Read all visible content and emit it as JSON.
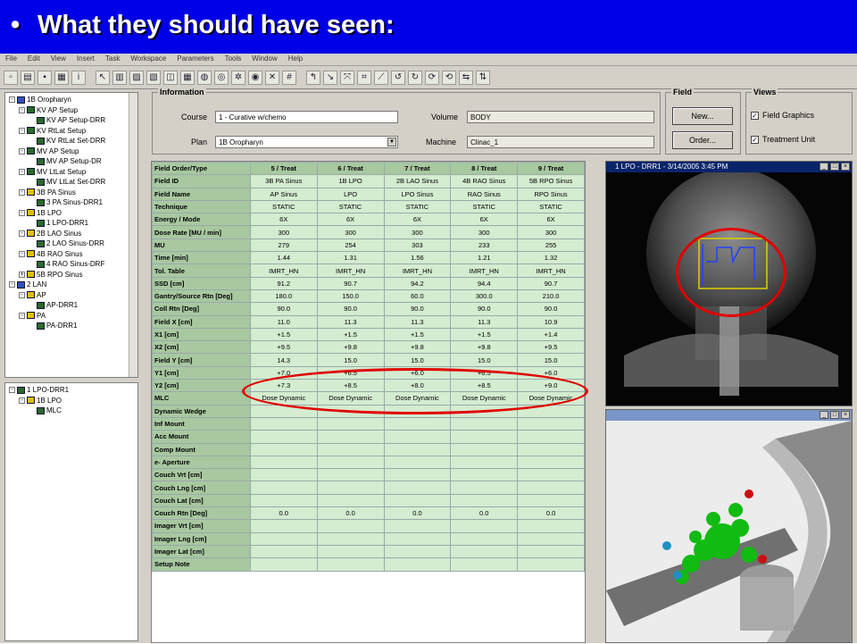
{
  "banner": {
    "bullet": "•",
    "title": "What they should have seen:"
  },
  "menu": [
    "File",
    "Edit",
    "View",
    "Insert",
    "Task",
    "Workspace",
    "Parameters",
    "Tools",
    "Window",
    "Help"
  ],
  "tree_top": [
    {
      "label": "1B Oropharyn",
      "indent": 0,
      "exp": "-",
      "ico": "b"
    },
    {
      "label": "KV AP Setup",
      "indent": 1,
      "exp": "-",
      "ico": "g"
    },
    {
      "label": "KV AP Setup-DRR",
      "indent": 2,
      "exp": "",
      "ico": "g"
    },
    {
      "label": "KV RtLat Setup",
      "indent": 1,
      "exp": "-",
      "ico": "g"
    },
    {
      "label": "KV RtLat Set-DRR",
      "indent": 2,
      "exp": "",
      "ico": "g"
    },
    {
      "label": "MV AP Setup",
      "indent": 1,
      "exp": "-",
      "ico": "g"
    },
    {
      "label": "MV AP Setup-DR",
      "indent": 2,
      "exp": "",
      "ico": "g"
    },
    {
      "label": "MV LtLat Setup",
      "indent": 1,
      "exp": "-",
      "ico": "g"
    },
    {
      "label": "MV LtLat Set-DRR",
      "indent": 2,
      "exp": "",
      "ico": "g"
    },
    {
      "label": "3B PA Sinus",
      "indent": 1,
      "exp": "-",
      "ico": "y"
    },
    {
      "label": "3 PA Sinus-DRR1",
      "indent": 2,
      "exp": "",
      "ico": "g"
    },
    {
      "label": "1B LPO",
      "indent": 1,
      "exp": "-",
      "ico": "y"
    },
    {
      "label": "1 LPO-DRR1",
      "indent": 2,
      "exp": "",
      "ico": "g"
    },
    {
      "label": "2B LAO Sinus",
      "indent": 1,
      "exp": "-",
      "ico": "y"
    },
    {
      "label": "2 LAO Sinus-DRR",
      "indent": 2,
      "exp": "",
      "ico": "g"
    },
    {
      "label": "4B RAO Sinus",
      "indent": 1,
      "exp": "-",
      "ico": "y"
    },
    {
      "label": "4 RAO Sinus-DRF",
      "indent": 2,
      "exp": "",
      "ico": "g"
    },
    {
      "label": "5B RPO Sinus",
      "indent": 1,
      "exp": "+",
      "ico": "y"
    },
    {
      "label": "2 LAN",
      "indent": 0,
      "exp": "-",
      "ico": "b"
    },
    {
      "label": "AP",
      "indent": 1,
      "exp": "-",
      "ico": "y"
    },
    {
      "label": "AP-DRR1",
      "indent": 2,
      "exp": "",
      "ico": "g"
    },
    {
      "label": "PA",
      "indent": 1,
      "exp": "-",
      "ico": "y"
    },
    {
      "label": "PA-DRR1",
      "indent": 2,
      "exp": "",
      "ico": "g"
    }
  ],
  "tree_bottom": [
    {
      "label": "1 LPO-DRR1",
      "indent": 0,
      "exp": "-",
      "ico": "g"
    },
    {
      "label": "1B LPO",
      "indent": 1,
      "exp": "-",
      "ico": "y"
    },
    {
      "label": "MLC",
      "indent": 2,
      "exp": "",
      "ico": "g"
    }
  ],
  "info": {
    "title": "Information",
    "course_label": "Course",
    "course_value": "1 - Curative w/chemo",
    "plan_label": "Plan",
    "plan_value": "1B Oropharyn",
    "volume_label": "Volume",
    "volume_value": "BODY",
    "machine_label": "Machine",
    "machine_value": "Clinac_1"
  },
  "field_group": {
    "title": "Field",
    "new_label": "New...",
    "order_label": "Order..."
  },
  "views_group": {
    "title": "Views",
    "graphics_label": "Field Graphics",
    "unit_label": "Treatment Unit"
  },
  "table": {
    "header": [
      "Field Order/Type",
      "5 / Treat",
      "6 / Treat",
      "7 / Treat",
      "8 / Treat",
      "9 / Treat"
    ],
    "rows": [
      [
        "Field ID",
        "3B PA Sinus",
        "1B LPO",
        "2B LAO Sinus",
        "4B RAO Sinus",
        "5B RPO Sinus"
      ],
      [
        "Field Name",
        "AP Sinus",
        "LPO",
        "LPO Sinus",
        "RAO Sinus",
        "RPO Sinus"
      ],
      [
        "Technique",
        "STATIC",
        "STATIC",
        "STATIC",
        "STATIC",
        "STATIC"
      ],
      [
        "Energy / Mode",
        "6X",
        "6X",
        "6X",
        "6X",
        "6X"
      ],
      [
        "Dose Rate [MU / min]",
        "300",
        "300",
        "300",
        "300",
        "300"
      ],
      [
        "MU",
        "279",
        "254",
        "303",
        "233",
        "255"
      ],
      [
        "Time [min]",
        "1.44",
        "1.31",
        "1.56",
        "1.21",
        "1.32"
      ],
      [
        "Tol. Table",
        "IMRT_HN",
        "IMRT_HN",
        "IMRT_HN",
        "IMRT_HN",
        "IMRT_HN"
      ],
      [
        "SSD [cm]",
        "91.2",
        "90.7",
        "94.2",
        "94.4",
        "90.7"
      ],
      [
        "Gantry/Source Rtn [Deg]",
        "180.0",
        "150.0",
        "60.0",
        "300.0",
        "210.0"
      ],
      [
        "Coll Rtn [Deg]",
        "90.0",
        "90.0",
        "90.0",
        "90.0",
        "90.0"
      ],
      [
        "Field X [cm]",
        "11.0",
        "11.3",
        "11.3",
        "11.3",
        "10.9"
      ],
      [
        "X1 [cm]",
        "+1.5",
        "+1.5",
        "+1.5",
        "+1.5",
        "+1.4"
      ],
      [
        "X2 [cm]",
        "+9.5",
        "+9.8",
        "+9.8",
        "+9.8",
        "+9.5"
      ],
      [
        "Field Y [cm]",
        "14.3",
        "15.0",
        "15.0",
        "15.0",
        "15.0"
      ],
      [
        "Y1 [cm]",
        "+7.0",
        "+6.5",
        "+6.0",
        "+6.5",
        "+6.0"
      ],
      [
        "Y2 [cm]",
        "+7.3",
        "+8.5",
        "+8.0",
        "+8.5",
        "+9.0"
      ],
      [
        "MLC",
        "Dose Dynamic",
        "Dose Dynamic",
        "Dose Dynamic",
        "Dose Dynamic",
        "Dose Dynamic"
      ],
      [
        "Dynamic Wedge",
        "",
        "",
        "",
        "",
        ""
      ],
      [
        "Inf Mount",
        "",
        "",
        "",
        "",
        ""
      ],
      [
        "Acc Mount",
        "",
        "",
        "",
        "",
        ""
      ],
      [
        "Comp Mount",
        "",
        "",
        "",
        "",
        ""
      ],
      [
        "e- Aperture",
        "",
        "",
        "",
        "",
        ""
      ],
      [
        "Couch Vrt [cm]",
        "",
        "",
        "",
        "",
        ""
      ],
      [
        "Couch Lng [cm]",
        "",
        "",
        "",
        "",
        ""
      ],
      [
        "Couch Lat [cm]",
        "",
        "",
        "",
        "",
        ""
      ],
      [
        "Couch Rtn [Deg]",
        "0.0",
        "0.0",
        "0.0",
        "0.0",
        "0.0"
      ],
      [
        "Imager Vrt [cm]",
        "",
        "",
        "",
        "",
        ""
      ],
      [
        "Imager Lng [cm]",
        "",
        "",
        "",
        "",
        ""
      ],
      [
        "Imager Lat [cm]",
        "",
        "",
        "",
        "",
        ""
      ],
      [
        "Setup Note",
        "",
        "",
        "",
        "",
        ""
      ]
    ]
  },
  "drr_panel": {
    "title": "1 LPO - DRR1 - 3/14/2005 3:45 PM"
  },
  "btn_glyphs": {
    "min": "_",
    "max": "□",
    "close": "×"
  },
  "colors": {
    "banner": "#0000e6",
    "annotation": "#e00000",
    "table_header": "#a8c8a0",
    "table_cell": "#d4ecd0"
  }
}
